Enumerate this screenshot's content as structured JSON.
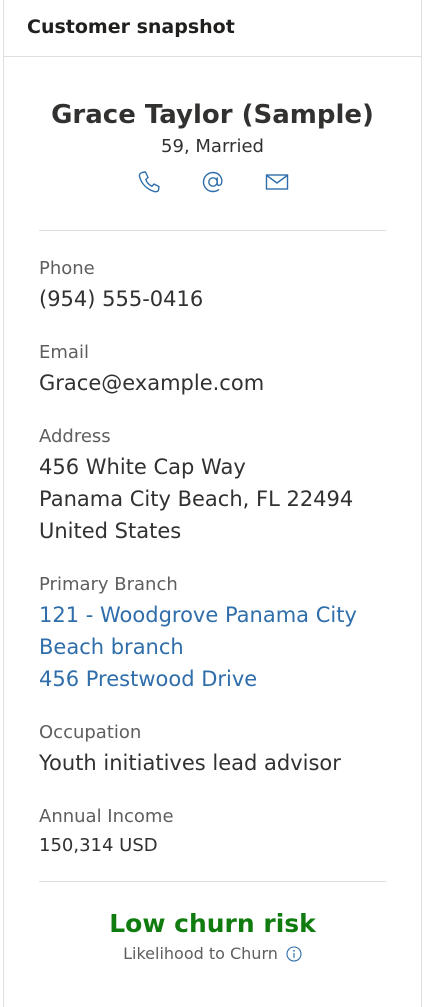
{
  "card": {
    "title": "Customer snapshot"
  },
  "customer": {
    "name": "Grace Taylor (Sample)",
    "age_status": "59, Married",
    "actions": {
      "call": "phone-icon",
      "email": "at-icon",
      "message": "mail-icon"
    }
  },
  "fields": {
    "phone": {
      "label": "Phone",
      "value": "(954) 555-0416"
    },
    "email": {
      "label": "Email",
      "value": "Grace@example.com"
    },
    "address": {
      "label": "Address",
      "line1": "456 White Cap Way",
      "line2": "Panama City Beach, FL 22494",
      "line3": "United States"
    },
    "branch": {
      "label": "Primary Branch",
      "line1": "121 - Woodgrove Panama City",
      "line2": "Beach branch",
      "line3": "456 Prestwood Drive"
    },
    "occupation": {
      "label": "Occupation",
      "value": "Youth initiatives lead advisor"
    },
    "income": {
      "label": "Annual Income",
      "value": "150,314 USD"
    }
  },
  "churn": {
    "title": "Low churn risk",
    "subtitle": "Likelihood to Churn",
    "info_icon": "info-icon"
  },
  "colors": {
    "link": "#2f6eaa",
    "churn_low": "#107c10",
    "icon": "#2f6eaa"
  }
}
